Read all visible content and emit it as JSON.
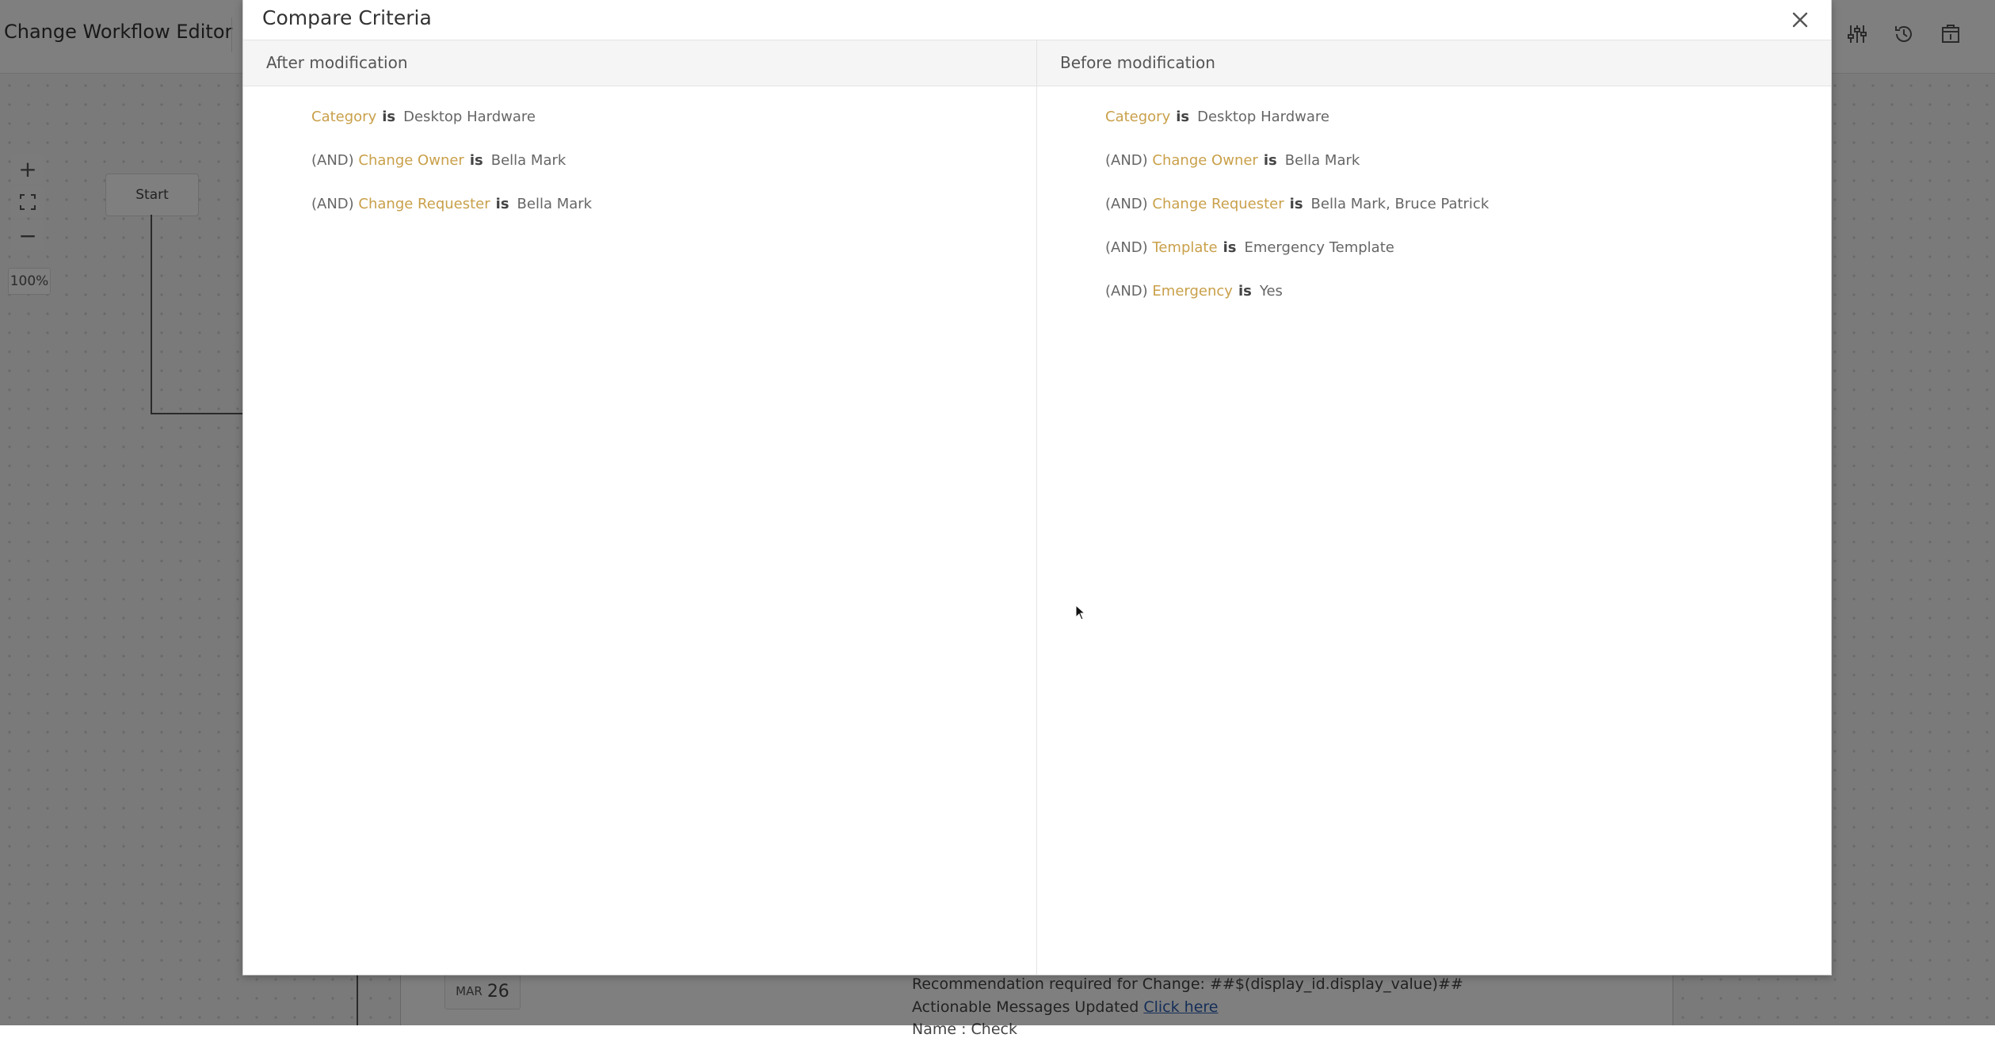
{
  "background": {
    "app_title": "Change Workflow Editor",
    "zoom_in_label": "+",
    "zoom_out_label": "−",
    "zoom_level": "100%",
    "start_node_label": "Start",
    "notification": {
      "month": "MAR",
      "day": "26",
      "line1": "Recommendation required for Change: ##$(display_id.display_value)##",
      "line2_text": "Actionable Messages Updated",
      "line2_link": "Click here",
      "line3": "Name : Check"
    },
    "header_icons": [
      "settings-sliders-icon",
      "history-icon",
      "export-icon"
    ]
  },
  "modal": {
    "title": "Compare Criteria",
    "close_icon": "close-icon",
    "after": {
      "header": "After modification",
      "criteria": [
        {
          "prefix": "",
          "field": "Category",
          "op": "is",
          "value": "Desktop Hardware"
        },
        {
          "prefix": "(AND)",
          "field": "Change Owner",
          "op": "is",
          "value": "Bella Mark"
        },
        {
          "prefix": "(AND)",
          "field": "Change Requester",
          "op": "is",
          "value": "Bella Mark"
        }
      ]
    },
    "before": {
      "header": "Before modification",
      "criteria": [
        {
          "prefix": "",
          "field": "Category",
          "op": "is",
          "value": "Desktop Hardware"
        },
        {
          "prefix": "(AND)",
          "field": "Change Owner",
          "op": "is",
          "value": "Bella Mark"
        },
        {
          "prefix": "(AND)",
          "field": "Change Requester",
          "op": "is",
          "value": "Bella Mark, Bruce Patrick"
        },
        {
          "prefix": "(AND)",
          "field": "Template",
          "op": "is",
          "value": "Emergency Template"
        },
        {
          "prefix": "(AND)",
          "field": "Emergency",
          "op": "is",
          "value": "Yes"
        }
      ]
    }
  },
  "colors": {
    "field_accent": "#c9a04a",
    "overlay": "rgba(0,0,0,0.5)"
  }
}
